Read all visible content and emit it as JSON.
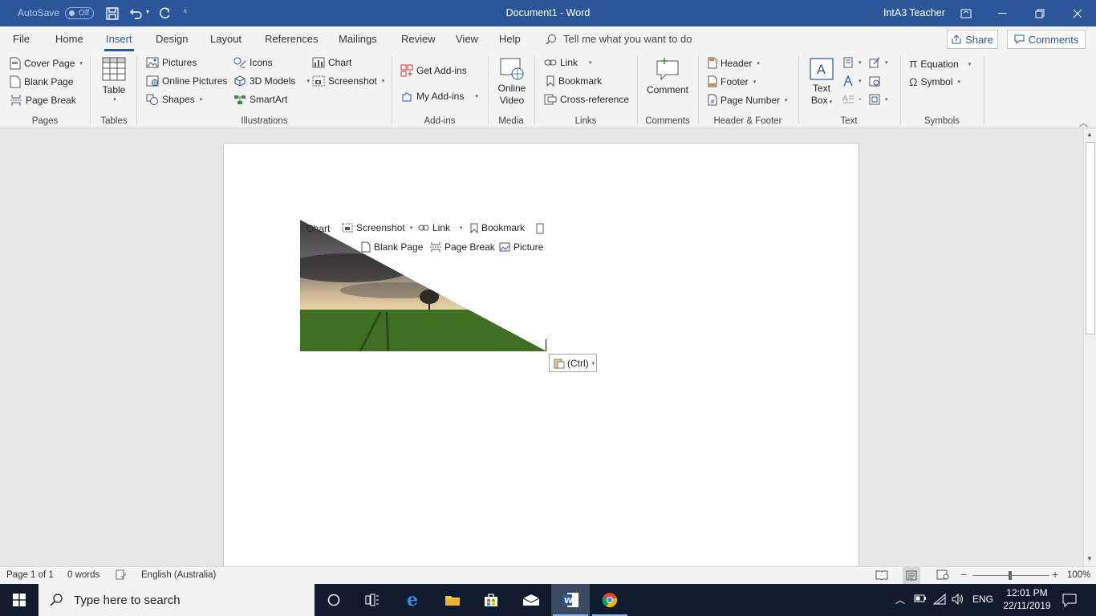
{
  "titlebar": {
    "autosave_label": "AutoSave",
    "autosave_state": "Off",
    "document_title": "Document1  -  Word",
    "user": "IntA3 Teacher"
  },
  "tabs": [
    "File",
    "Home",
    "Insert",
    "Design",
    "Layout",
    "References",
    "Mailings",
    "Review",
    "View",
    "Help"
  ],
  "active_tab": "Insert",
  "tell_me": "Tell me what you want to do",
  "share_label": "Share",
  "comments_label": "Comments",
  "ribbon": {
    "pages": {
      "label": "Pages",
      "items": [
        "Cover Page",
        "Blank Page",
        "Page Break"
      ]
    },
    "tables": {
      "label": "Tables",
      "table": "Table"
    },
    "illustrations": {
      "label": "Illustrations",
      "pictures": "Pictures",
      "online_pictures": "Online Pictures",
      "shapes": "Shapes",
      "icons": "Icons",
      "models_3d": "3D Models",
      "smartart": "SmartArt",
      "chart": "Chart",
      "screenshot": "Screenshot"
    },
    "addins": {
      "label": "Add-ins",
      "get": "Get Add-ins",
      "my": "My Add-ins"
    },
    "media": {
      "label": "Media",
      "online_video_1": "Online",
      "online_video_2": "Video"
    },
    "links": {
      "label": "Links",
      "link": "Link",
      "bookmark": "Bookmark",
      "cross_reference": "Cross-reference"
    },
    "comments": {
      "label": "Comments",
      "comment": "Comment"
    },
    "header_footer": {
      "label": "Header & Footer",
      "header": "Header",
      "footer": "Footer",
      "page_number": "Page Number"
    },
    "text": {
      "label": "Text",
      "text_box_1": "Text",
      "text_box_2": "Box"
    },
    "symbols": {
      "label": "Symbols",
      "equation": "Equation",
      "symbol": "Symbol"
    }
  },
  "pasted_image": {
    "chart": "Chart",
    "screenshot": "Screenshot",
    "link": "Link",
    "bookmark": "Bookmark",
    "blank_page": "Blank Page",
    "page_break": "Page Break",
    "picture": "Picture"
  },
  "paste_options": "(Ctrl)",
  "status": {
    "page": "Page 1 of 1",
    "words": "0 words",
    "language": "English (Australia)",
    "zoom": "100%"
  },
  "taskbar": {
    "search_placeholder": "Type here to search",
    "language": "ENG",
    "time": "12:01 PM",
    "date": "22/11/2019"
  }
}
